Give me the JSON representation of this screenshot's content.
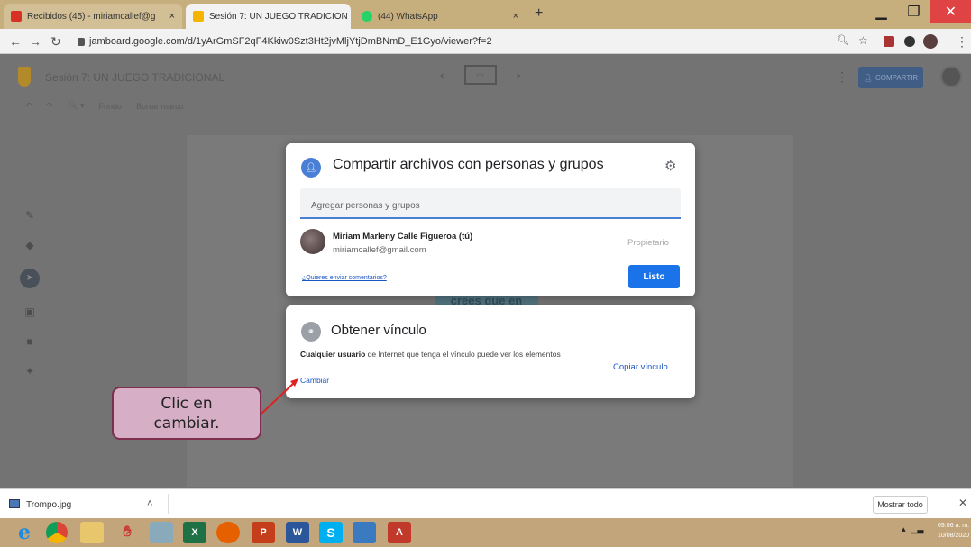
{
  "browser": {
    "tabs": [
      {
        "label": "Recibidos (45) - miriamcallef@g",
        "icon": "gmail-icon",
        "color": "#d93025"
      },
      {
        "label": "Sesión 7: UN JUEGO TRADICION",
        "icon": "jamboard-icon",
        "color": "#f4b400"
      },
      {
        "label": "(44) WhatsApp",
        "icon": "whatsapp-icon",
        "color": "#25d366"
      }
    ],
    "new_tab": "+",
    "url": "jamboard.google.com/d/1yArGmSF2qF4Kkiw0Szt3Ht2jvMljYtjDmBNmD_E1Gyo/viewer?f=2"
  },
  "jamboard": {
    "title": "Sesión 7: UN JUEGO TRADICIONAL",
    "share_label": "COMPARTIR",
    "toolbar": [
      "Fondo",
      "Borrar marco"
    ],
    "canvas_text": "crees que en"
  },
  "share_dialog": {
    "title": "Compartir archivos con personas y grupos",
    "input_placeholder": "Agregar personas y grupos",
    "owner_name": "Miriam Marleny Calle Figueroa (tú)",
    "owner_email": "miriamcallef@gmail.com",
    "owner_role": "Propietario",
    "feedback_link": "¿Quieres enviar comentarios?",
    "done_label": "Listo"
  },
  "link_dialog": {
    "title": "Obtener vínculo",
    "desc_bold": "Cualquier usuario",
    "desc_rest": " de Internet que tenga el vínculo puede ver los elementos",
    "change_label": "Cambiar",
    "copy_label": "Copiar vínculo"
  },
  "callout": {
    "line1": "Clic en",
    "line2": "cambiar."
  },
  "downloads": {
    "file": "Trompo.jpg",
    "show_all": "Mostrar todo"
  },
  "taskbar": {
    "time": "09:06 a. m.",
    "date": "10/08/2020"
  }
}
